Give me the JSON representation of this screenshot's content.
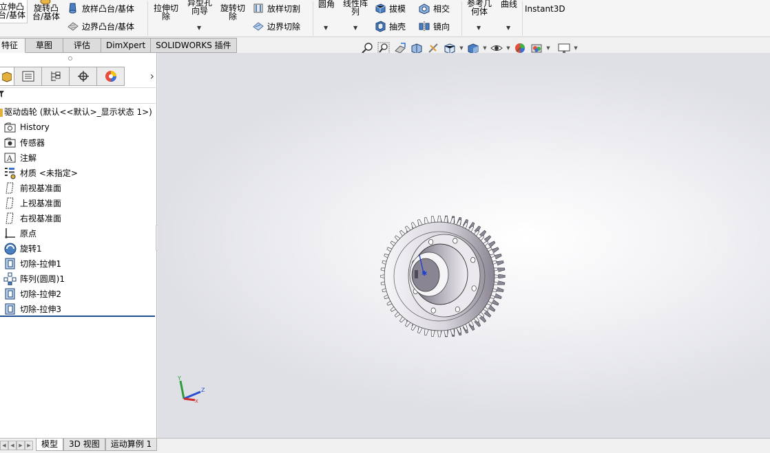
{
  "ribbon": {
    "extrude_boss": [
      "立伸凸",
      "台/基体"
    ],
    "revolve_boss": [
      "旋转凸",
      "台/基体"
    ],
    "loft_boss": "放样凸台/基体",
    "boundary_boss": "边界凸台/基体",
    "extrude_cut": [
      "拉伸切",
      "除"
    ],
    "hole_wizard": [
      "异型孔",
      "向导"
    ],
    "revolve_cut": [
      "旋转切",
      "除"
    ],
    "loft_cut": "放样切割",
    "boundary_cut": "边界切除",
    "fillet": "圆角",
    "linear_pattern": [
      "线性阵",
      "列"
    ],
    "draft": "拔模",
    "shell": "抽壳",
    "intersect": "相交",
    "mirror": "镜向",
    "ref_geometry": [
      "参考几",
      "何体"
    ],
    "curves": "曲线",
    "instant3d": "Instant3D"
  },
  "command_tabs": [
    "特征",
    "草图",
    "评估",
    "DimXpert",
    "SOLIDWORKS 插件"
  ],
  "feature_tree": {
    "root": "驱动齿轮  (默认<<默认>_显示状态 1>)",
    "items": [
      {
        "label": "History",
        "icon": "history-folder-icon"
      },
      {
        "label": "传感器",
        "icon": "sensor-icon"
      },
      {
        "label": "注解",
        "icon": "annotation-icon"
      },
      {
        "label": "材质 <未指定>",
        "icon": "material-icon"
      },
      {
        "label": "前视基准面",
        "icon": "plane-icon"
      },
      {
        "label": "上视基准面",
        "icon": "plane-icon"
      },
      {
        "label": "右视基准面",
        "icon": "plane-icon"
      },
      {
        "label": "原点",
        "icon": "origin-icon"
      },
      {
        "label": "旋转1",
        "icon": "revolve-icon"
      },
      {
        "label": "切除-拉伸1",
        "icon": "cut-extrude-icon"
      },
      {
        "label": "阵列(圆周)1",
        "icon": "circular-pattern-icon"
      },
      {
        "label": "切除-拉伸2",
        "icon": "cut-extrude-icon"
      },
      {
        "label": "切除-拉伸3",
        "icon": "cut-extrude-icon"
      }
    ]
  },
  "bottom_tabs": [
    "模型",
    "3D 视图",
    "运动算例 1"
  ],
  "triad": {
    "x": "X",
    "y": "Y",
    "z": "Z"
  },
  "colors": {
    "accent": "#1e4e8f",
    "ribbon_bg": "#f5f5f5",
    "viewport_bg": "#ffffff"
  }
}
